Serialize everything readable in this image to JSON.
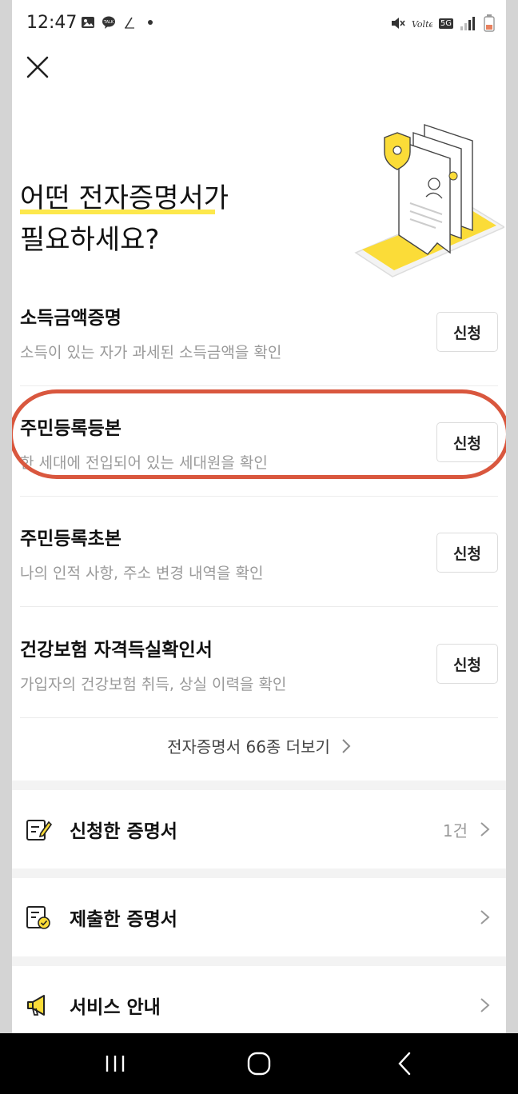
{
  "status_bar": {
    "time": "12:47",
    "network": "5G"
  },
  "header": {
    "close_icon": "close-icon"
  },
  "hero": {
    "title_line1": "어떤 전자증명서가",
    "title_line2": "필요하세요?"
  },
  "certificates": [
    {
      "title": "소득금액증명",
      "description": "소득이 있는 자가 과세된 소득금액을 확인",
      "button": "신청"
    },
    {
      "title": "주민등록등본",
      "description": "한 세대에 전입되어 있는 세대원을 확인",
      "button": "신청"
    },
    {
      "title": "주민등록초본",
      "description": "나의 인적 사항, 주소 변경 내역을 확인",
      "button": "신청"
    },
    {
      "title": "건강보험 자격득실확인서",
      "description": "가입자의 건강보험 취득, 상실 이력을 확인",
      "button": "신청"
    }
  ],
  "more_link": "전자증명서 66종 더보기",
  "menu": [
    {
      "label": "신청한 증명서",
      "count": "1건",
      "icon": "document-edit-icon"
    },
    {
      "label": "제출한 증명서",
      "count": "",
      "icon": "document-check-icon"
    },
    {
      "label": "서비스 안내",
      "count": "",
      "icon": "megaphone-icon"
    }
  ],
  "colors": {
    "accent_yellow": "#fde84c",
    "highlight_ring": "#d9573e"
  }
}
